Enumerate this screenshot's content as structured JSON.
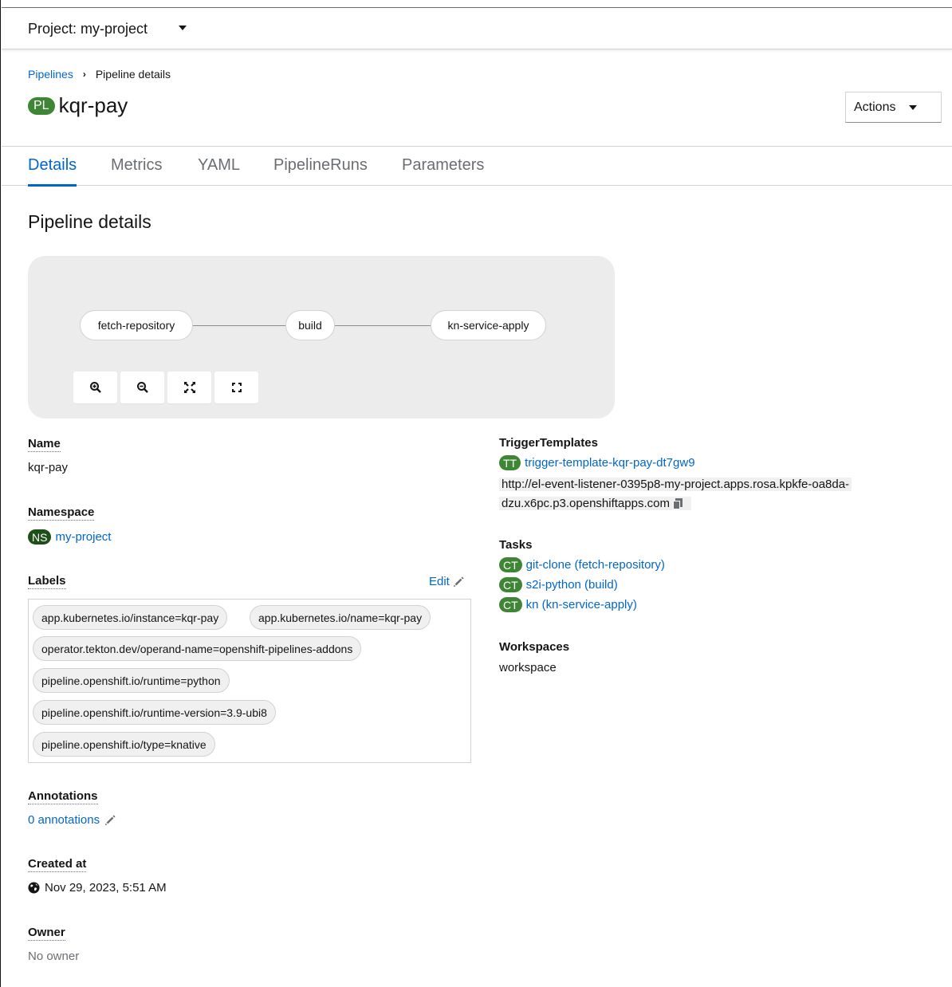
{
  "project_bar": {
    "label": "Project: my-project"
  },
  "breadcrumb": {
    "parent": "Pipelines",
    "current": "Pipeline details"
  },
  "header": {
    "badge": "PL",
    "title": "kqr-pay",
    "actions_label": "Actions"
  },
  "tabs": [
    "Details",
    "Metrics",
    "YAML",
    "PipelineRuns",
    "Parameters"
  ],
  "section_title": "Pipeline details",
  "topology": {
    "nodes": [
      "fetch-repository",
      "build",
      "kn-service-apply"
    ],
    "controls": [
      "zoom-in-icon",
      "zoom-out-icon",
      "fit-to-screen-icon",
      "reset-view-icon"
    ]
  },
  "details": {
    "name_label": "Name",
    "name_value": "kqr-pay",
    "namespace_label": "Namespace",
    "namespace_badge": "NS",
    "namespace_value": "my-project",
    "labels_label": "Labels",
    "labels_edit": "Edit",
    "labels": [
      "app.kubernetes.io/instance=kqr-pay",
      "app.kubernetes.io/name=kqr-pay",
      "operator.tekton.dev/operand-name=openshift-pipelines-addons",
      "pipeline.openshift.io/runtime=python",
      "pipeline.openshift.io/runtime-version=3.9-ubi8",
      "pipeline.openshift.io/type=knative"
    ],
    "annotations_label": "Annotations",
    "annotations_value": "0 annotations",
    "created_label": "Created at",
    "created_value": "Nov 29, 2023, 5:51 AM",
    "owner_label": "Owner",
    "owner_value": "No owner"
  },
  "right": {
    "trigger_label": "TriggerTemplates",
    "trigger_badge": "TT",
    "trigger_value": "trigger-template-kqr-pay-dt7gw9",
    "trigger_url_line1": "http://el-event-listener-0395p8-my-project.apps.rosa.kpkfe-oa8da-",
    "trigger_url_line2": "dzu.x6pc.p3.openshiftapps.com",
    "tasks_label": "Tasks",
    "task_badge": "CT",
    "tasks": [
      "git-clone (fetch-repository)",
      "s2i-python (build)",
      "kn (kn-service-apply)"
    ],
    "workspaces_label": "Workspaces",
    "workspaces_value": "workspace"
  },
  "colors": {
    "link": "#0066cc",
    "badge_green": "#3e8635",
    "ns_badge": "#1e4f18"
  }
}
